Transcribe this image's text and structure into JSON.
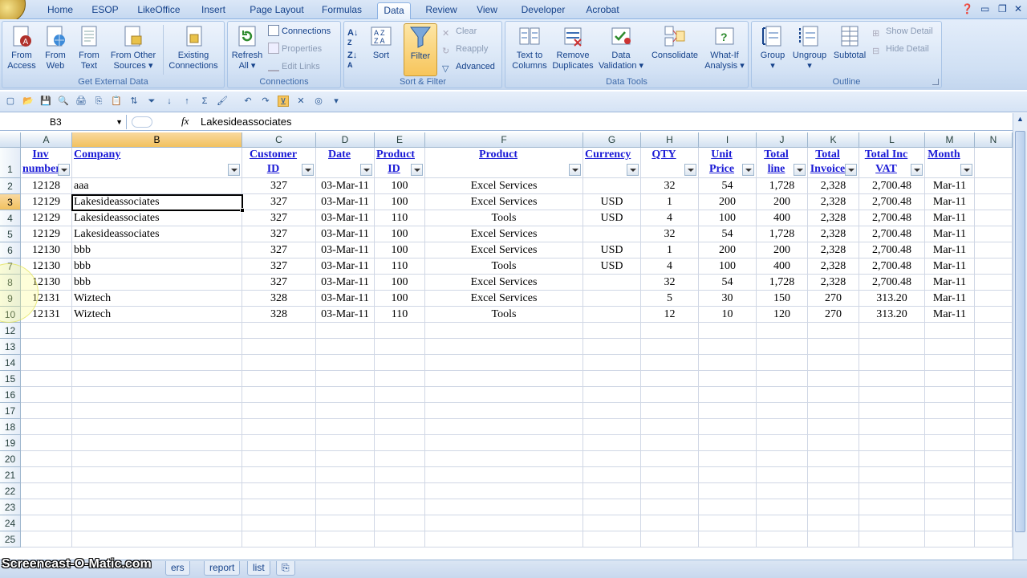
{
  "ribbon_tabs": [
    "Home",
    "ESOP",
    "LikeOffice",
    "Insert",
    "Page Layout",
    "Formulas",
    "Data",
    "Review",
    "View",
    "Developer",
    "Acrobat"
  ],
  "active_tab": "Data",
  "groups": {
    "get_external_data": {
      "label": "Get External Data",
      "buttons": [
        "From\nAccess",
        "From\nWeb",
        "From\nText",
        "From Other\nSources ▾",
        "Existing\nConnections"
      ]
    },
    "connections": {
      "label": "Connections",
      "refresh": "Refresh\nAll ▾",
      "small": [
        "Connections",
        "Properties",
        "Edit Links"
      ]
    },
    "sort_filter": {
      "label": "Sort & Filter",
      "sort": "Sort",
      "filter": "Filter",
      "small": [
        "Clear",
        "Reapply",
        "Advanced"
      ]
    },
    "data_tools": {
      "label": "Data Tools",
      "buttons": [
        "Text to\nColumns",
        "Remove\nDuplicates",
        "Data\nValidation ▾",
        "Consolidate",
        "What-If\nAnalysis ▾"
      ]
    },
    "outline": {
      "label": "Outline",
      "buttons": [
        "Group\n▾",
        "Ungroup\n▾",
        "Subtotal"
      ],
      "small": [
        "Show Detail",
        "Hide Detail"
      ]
    }
  },
  "formula_bar": {
    "name_box": "B3",
    "fx": "fx",
    "content": "Lakesideassociates"
  },
  "columns": [
    "A",
    "B",
    "C",
    "D",
    "E",
    "F",
    "G",
    "H",
    "I",
    "J",
    "K",
    "L",
    "M",
    "N"
  ],
  "selected_column": "B",
  "selected_row": "3",
  "header_row": [
    "Inv number",
    "Company",
    "Customer ID",
    "Date",
    "Product ID",
    "Product",
    "Currency",
    "QTY",
    "Unit Price",
    "Total line",
    "Total Invoice",
    "Total Inc VAT",
    "Month"
  ],
  "rows": [
    [
      "12128",
      "aaa",
      "327",
      "03-Mar-11",
      "100",
      "Excel Services",
      "",
      "32",
      "54",
      "1,728",
      "2,328",
      "2,700.48",
      "Mar-11"
    ],
    [
      "12129",
      "Lakesideassociates",
      "327",
      "03-Mar-11",
      "100",
      "Excel Services",
      "USD",
      "1",
      "200",
      "200",
      "2,328",
      "2,700.48",
      "Mar-11"
    ],
    [
      "12129",
      "Lakesideassociates",
      "327",
      "03-Mar-11",
      "110",
      "Tools",
      "USD",
      "4",
      "100",
      "400",
      "2,328",
      "2,700.48",
      "Mar-11"
    ],
    [
      "12129",
      "Lakesideassociates",
      "327",
      "03-Mar-11",
      "100",
      "Excel Services",
      "",
      "32",
      "54",
      "1,728",
      "2,328",
      "2,700.48",
      "Mar-11"
    ],
    [
      "12130",
      "bbb",
      "327",
      "03-Mar-11",
      "100",
      "Excel Services",
      "USD",
      "1",
      "200",
      "200",
      "2,328",
      "2,700.48",
      "Mar-11"
    ],
    [
      "12130",
      "bbb",
      "327",
      "03-Mar-11",
      "110",
      "Tools",
      "USD",
      "4",
      "100",
      "400",
      "2,328",
      "2,700.48",
      "Mar-11"
    ],
    [
      "12130",
      "bbb",
      "327",
      "03-Mar-11",
      "100",
      "Excel Services",
      "",
      "32",
      "54",
      "1,728",
      "2,328",
      "2,700.48",
      "Mar-11"
    ],
    [
      "12131",
      "Wiztech",
      "328",
      "03-Mar-11",
      "100",
      "Excel Services",
      "",
      "5",
      "30",
      "150",
      "270",
      "313.20",
      "Mar-11"
    ],
    [
      "12131",
      "Wiztech",
      "328",
      "03-Mar-11",
      "110",
      "Tools",
      "",
      "12",
      "10",
      "120",
      "270",
      "313.20",
      "Mar-11"
    ]
  ],
  "row_numbers": [
    "1",
    "2",
    "3",
    "4",
    "5",
    "6",
    "7",
    "8",
    "9",
    "10",
    "12",
    "13",
    "14",
    "15",
    "16",
    "17",
    "18",
    "19",
    "20",
    "21",
    "22",
    "23",
    "24",
    "25"
  ],
  "sheet_tabs": [
    "ers",
    "report",
    "list"
  ],
  "watermark": "Screencast-O-Matic.com"
}
